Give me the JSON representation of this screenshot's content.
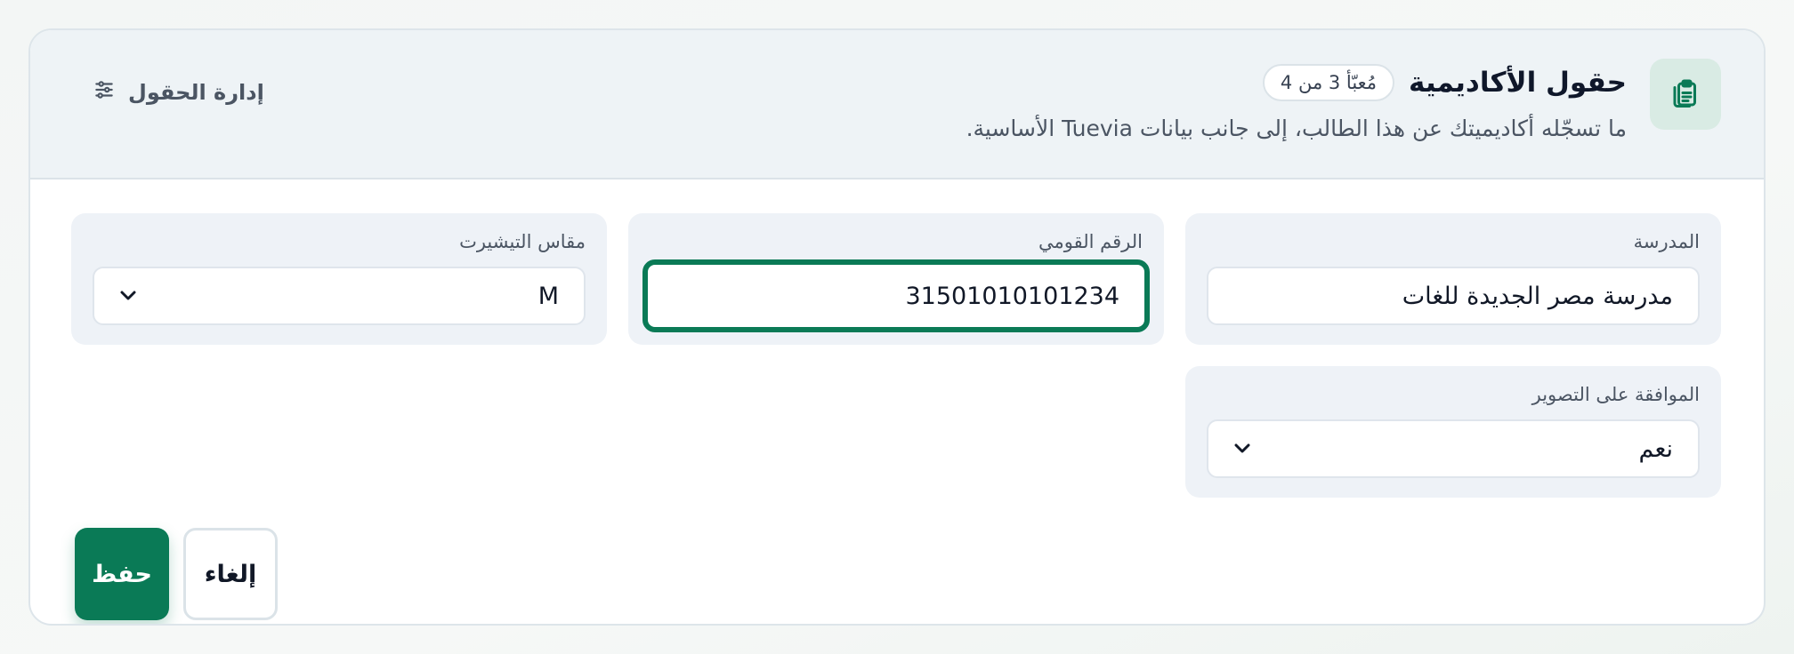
{
  "header": {
    "icon": "clipboard-icon",
    "title": "حقول الأكاديمية",
    "badge": "مُعبّأ 3 من 4",
    "subtitle": "ما تسجّله أكاديميتك عن هذا الطالب، إلى جانب بيانات Tuevia الأساسية.",
    "manage_label": "إدارة الحقول",
    "manage_icon": "sliders-icon"
  },
  "fields": {
    "school": {
      "label": "المدرسة",
      "value": "مدرسة مصر الجديدة للغات"
    },
    "national_id": {
      "label": "الرقم القومي",
      "value": "31501010101234"
    },
    "tshirt_size": {
      "label": "مقاس التيشيرت",
      "value": "M"
    },
    "photo_consent": {
      "label": "الموافقة على التصوير",
      "value": "نعم"
    }
  },
  "actions": {
    "save_label": "حفظ",
    "cancel_label": "إلغاء"
  },
  "colors": {
    "accent": "#0a7a56",
    "header_bg": "#eef3f6",
    "field_bg": "#eef2f7"
  }
}
